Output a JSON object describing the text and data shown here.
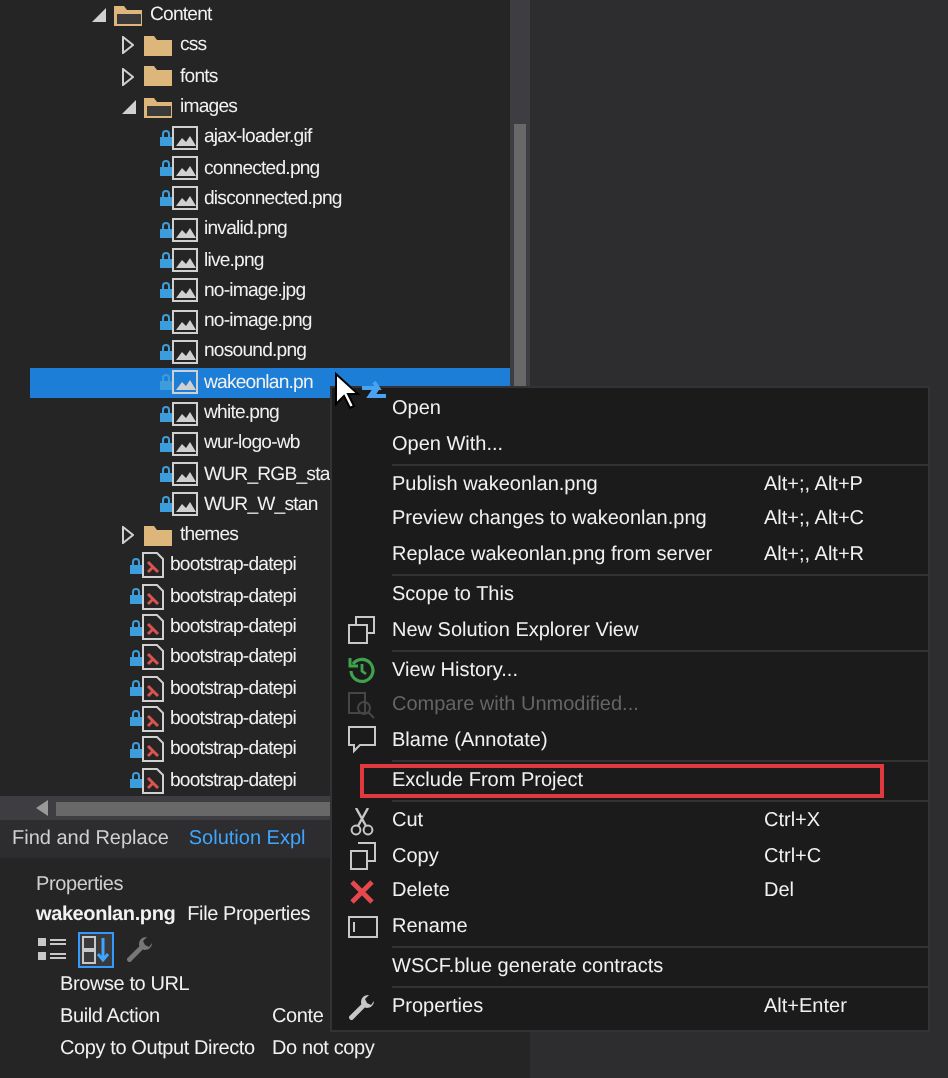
{
  "tree": [
    {
      "label": "Content",
      "kind": "folder",
      "expanded": true,
      "selected": false,
      "children": [
        {
          "label": "css",
          "kind": "folder",
          "expanded": false,
          "selected": false
        },
        {
          "label": "fonts",
          "kind": "folder",
          "expanded": false,
          "selected": false
        },
        {
          "label": "images",
          "kind": "folder",
          "expanded": true,
          "selected": false,
          "children": [
            {
              "label": "ajax-loader.gif",
              "kind": "image",
              "selected": false
            },
            {
              "label": "connected.png",
              "kind": "image",
              "selected": false
            },
            {
              "label": "disconnected.png",
              "kind": "image",
              "selected": false
            },
            {
              "label": "invalid.png",
              "kind": "image",
              "selected": false
            },
            {
              "label": "live.png",
              "kind": "image",
              "selected": false
            },
            {
              "label": "no-image.jpg",
              "kind": "image",
              "selected": false
            },
            {
              "label": "no-image.png",
              "kind": "image",
              "selected": false
            },
            {
              "label": "nosound.png",
              "kind": "image",
              "selected": false
            },
            {
              "label": "wakeonlan.pn",
              "kind": "image",
              "selected": true
            },
            {
              "label": "white.png",
              "kind": "image",
              "selected": false
            },
            {
              "label": "wur-logo-wb",
              "kind": "image",
              "selected": false
            },
            {
              "label": "WUR_RGB_sta",
              "kind": "image",
              "selected": false
            },
            {
              "label": "WUR_W_stan",
              "kind": "image",
              "selected": false
            }
          ]
        },
        {
          "label": "themes",
          "kind": "folder",
          "expanded": false,
          "selected": false
        },
        {
          "label": "bootstrap-datepi",
          "kind": "file",
          "selected": false
        },
        {
          "label": "bootstrap-datepi",
          "kind": "file",
          "selected": false
        },
        {
          "label": "bootstrap-datepi",
          "kind": "file",
          "selected": false
        },
        {
          "label": "bootstrap-datepi",
          "kind": "file",
          "selected": false
        },
        {
          "label": "bootstrap-datepi",
          "kind": "file",
          "selected": false
        },
        {
          "label": "bootstrap-datepi",
          "kind": "file",
          "selected": false
        },
        {
          "label": "bootstrap-datepi",
          "kind": "file",
          "selected": false
        },
        {
          "label": "bootstrap-datepi",
          "kind": "file",
          "selected": false
        }
      ]
    }
  ],
  "tabs": [
    {
      "label": "Find and Replace",
      "selected": false
    },
    {
      "label": "Solution Expl",
      "selected": true
    }
  ],
  "properties": {
    "title": "Properties",
    "object_name": "wakeonlan.png",
    "object_type": "File Properties",
    "rows": [
      {
        "name": "Browse to URL",
        "value": ""
      },
      {
        "name": "Build Action",
        "value": "Conte"
      },
      {
        "name": "Copy to Output Directo",
        "value": "Do not copy"
      }
    ]
  },
  "context_menu": [
    {
      "kind": "item",
      "label": "Open",
      "disabled": false,
      "highlighted": false
    },
    {
      "kind": "item",
      "label": "Open With...",
      "disabled": false,
      "highlighted": false
    },
    {
      "kind": "separator"
    },
    {
      "kind": "item",
      "label": "Publish wakeonlan.png",
      "shortcut": "Alt+;, Alt+P",
      "disabled": false,
      "highlighted": false
    },
    {
      "kind": "item",
      "label": "Preview changes to wakeonlan.png",
      "shortcut": "Alt+;, Alt+C",
      "disabled": false,
      "highlighted": false
    },
    {
      "kind": "item",
      "label": "Replace wakeonlan.png from server",
      "shortcut": "Alt+;, Alt+R",
      "disabled": false,
      "highlighted": false
    },
    {
      "kind": "separator"
    },
    {
      "kind": "item",
      "label": "Scope to This",
      "disabled": false,
      "highlighted": false
    },
    {
      "kind": "item",
      "label": "New Solution Explorer View",
      "disabled": false,
      "highlighted": false
    },
    {
      "kind": "separator"
    },
    {
      "kind": "item",
      "label": "View History...",
      "disabled": false,
      "highlighted": false
    },
    {
      "kind": "item",
      "label": "Compare with Unmodified...",
      "disabled": true,
      "highlighted": false
    },
    {
      "kind": "item",
      "label": "Blame (Annotate)",
      "disabled": false,
      "highlighted": false
    },
    {
      "kind": "separator"
    },
    {
      "kind": "item",
      "label": "Exclude From Project",
      "disabled": false,
      "highlighted": true
    },
    {
      "kind": "separator"
    },
    {
      "kind": "item",
      "label": "Cut",
      "shortcut": "Ctrl+X",
      "disabled": false,
      "highlighted": false
    },
    {
      "kind": "item",
      "label": "Copy",
      "shortcut": "Ctrl+C",
      "disabled": false,
      "highlighted": false
    },
    {
      "kind": "item",
      "label": "Delete",
      "shortcut": "Del",
      "disabled": false,
      "highlighted": false
    },
    {
      "kind": "item",
      "label": "Rename",
      "disabled": false,
      "highlighted": false
    },
    {
      "kind": "separator"
    },
    {
      "kind": "item",
      "label": "WSCF.blue generate contracts",
      "disabled": false,
      "highlighted": false
    },
    {
      "kind": "separator"
    },
    {
      "kind": "item",
      "label": "Properties",
      "shortcut": "Alt+Enter",
      "disabled": false,
      "highlighted": false
    }
  ]
}
